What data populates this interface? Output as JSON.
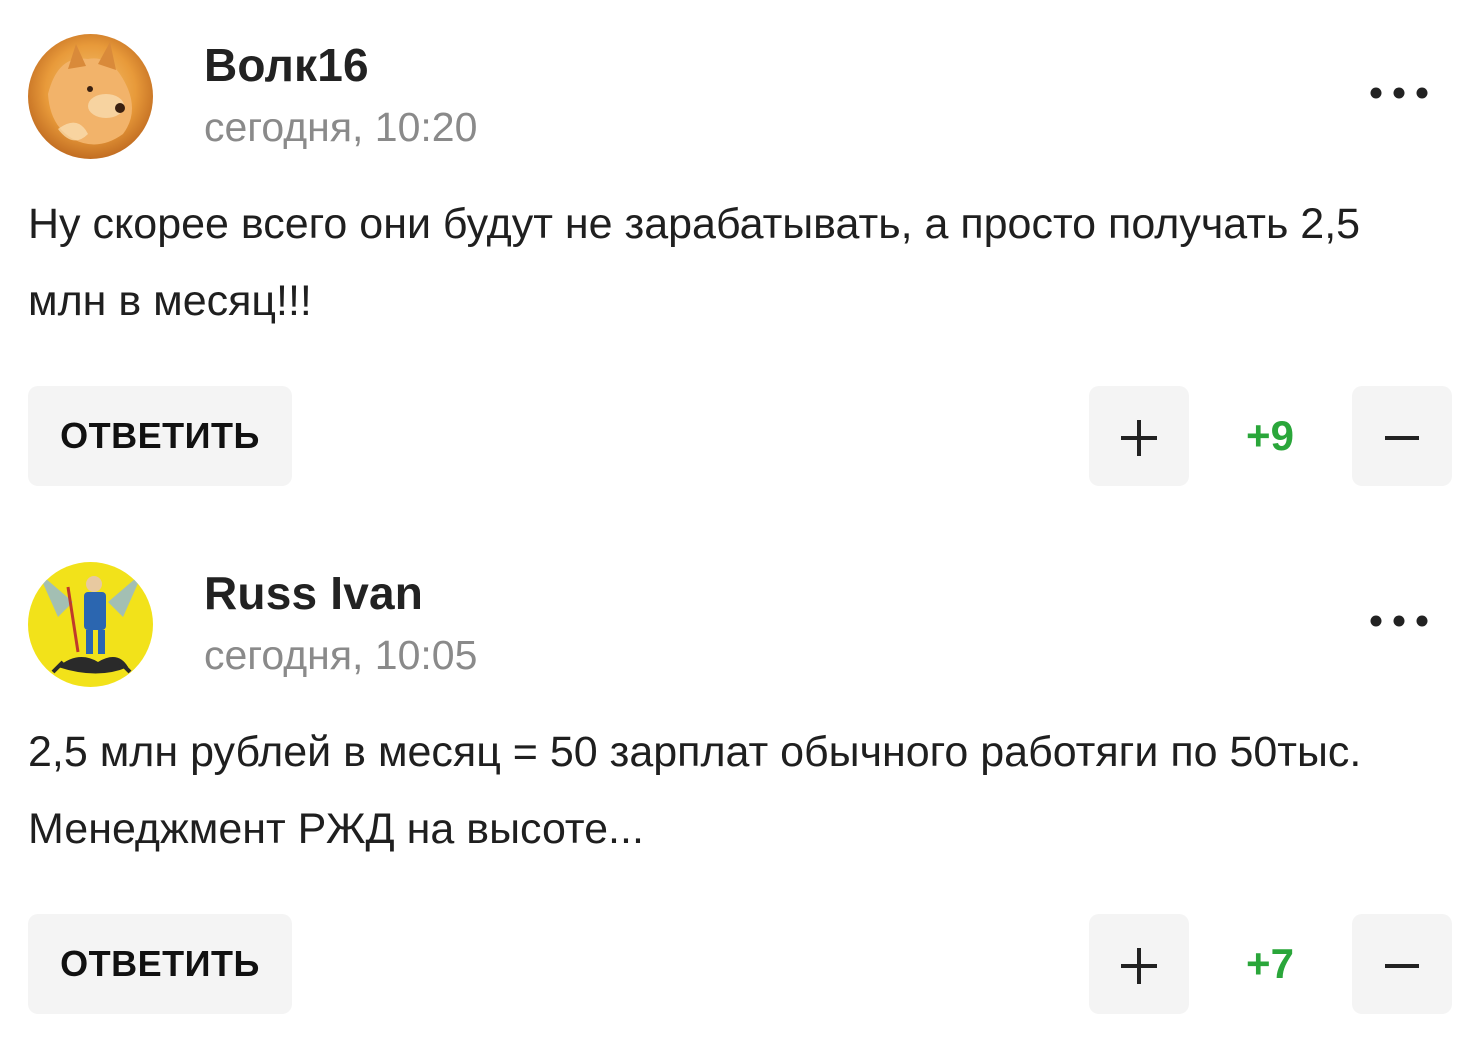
{
  "comments": [
    {
      "author": "Волк16",
      "time": "сегодня, 10:20",
      "text": "Ну скорее всего они будут не зарабатывать, а просто получать 2,5 млн в месяц!!!",
      "reply_label": "ОТВЕТИТЬ",
      "score": "+9",
      "avatar_icon": "wolf-photo-avatar"
    },
    {
      "author": "Russ Ivan",
      "time": "сегодня, 10:05",
      "text": "2,5 млн рублей в месяц = 50 зарплат обычного работяги по 50тыс. Менеджмент РЖД на высоте...",
      "reply_label": "ОТВЕТИТЬ",
      "score": "+7",
      "avatar_icon": "coat-of-arms-avatar"
    }
  ],
  "icons": {
    "more": "more-dots-icon",
    "plus": "plus-icon",
    "minus": "minus-icon"
  },
  "colors": {
    "score_positive": "#2aa63a",
    "button_bg": "#f4f4f4",
    "timestamp": "#8a8a8a"
  }
}
